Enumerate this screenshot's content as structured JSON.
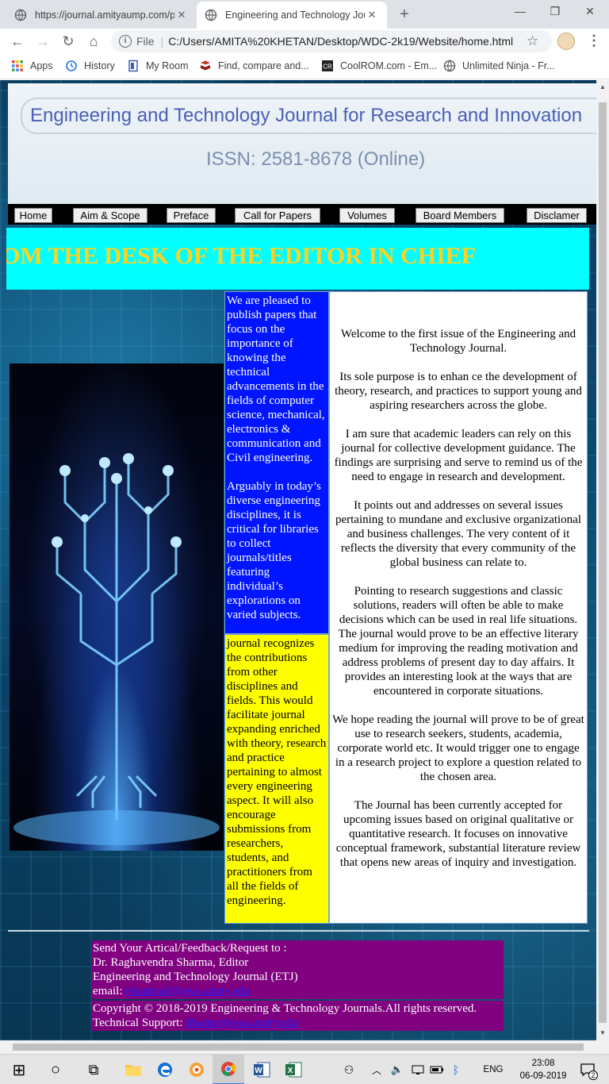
{
  "browser": {
    "tabs": [
      {
        "title": "https://journal.amityaump.com/p",
        "active": false
      },
      {
        "title": "Engineering and Technology Jour",
        "active": true
      }
    ],
    "new_tab": "+",
    "window_controls": {
      "minimize": "—",
      "restore": "❐",
      "close": "✕"
    },
    "toolbar": {
      "back": "←",
      "forward": "→",
      "reload": "↻",
      "home": "⌂",
      "scheme_label": "File",
      "separator": "|",
      "url": "C:/Users/AMITA%20KHETAN/Desktop/WDC-2k19/Website/home.html",
      "star": "☆",
      "menu": "⋮"
    },
    "bookmarks": [
      {
        "label": "Apps",
        "icon": "apps-grid-icon"
      },
      {
        "label": "History",
        "icon": "history-icon"
      },
      {
        "label": "My Room",
        "icon": "page-icon"
      },
      {
        "label": "Find, compare and...",
        "icon": "book-icon"
      },
      {
        "label": "CoolROM.com - Em...",
        "icon": "coolrom-icon"
      },
      {
        "label": "Unlimited Ninja - Fr...",
        "icon": "globe-icon"
      }
    ]
  },
  "site": {
    "journal_title": "Engineering and Technology Journal for Research and Innovation",
    "issn": "ISSN: 2581-8678 (Online)",
    "nav": [
      "Home",
      "Aim & Scope",
      "Preface",
      "Call for Papers",
      "Volumes",
      "Board Members",
      "Disclamer"
    ],
    "editor_heading": "FROM THE DESK OF THE EDITOR IN CHIEF",
    "blue_column": [
      "We are pleased to publish papers that focus on the importance of knowing the technical advancements in the fields of computer science, mechanical, electronics & communication and Civil engineering.",
      "Arguably in today’s diverse engineering disciplines, it is critical for libraries to collect journals/titles featuring individual’s explorations on varied subjects."
    ],
    "yellow_column": "journal recognizes the contributions from other disciplines and fields. This would facilitate journal expanding enriched with theory, research and practice pertaining to almost every engineering aspect. It will also encourage submissions from researchers, students, and practitioners from all the fields of engineering.",
    "welcome": [
      "Welcome to the first issue of the Engineering and Technology Journal.",
      "Its sole purpose is to enhan ce the development of theory, research, and practices to support young and aspiring researchers across the globe.",
      "I am sure that academic leaders can rely on this journal for collective development guidance. The findings are surprising and serve to remind us of the need to engage in research and development.",
      "It points out and addresses on several issues pertaining to mundane and exclusive organizational and business challenges. The very content of it reflects the diversity that every community of the global business can relate to.",
      "Pointing to research suggestions and classic solutions, readers will often be able to make decisions which can be used in real life situations.",
      "The journal would prove to be an effective literary medium for improving the reading motivation and address problems of present day to day affairs. It provides an interesting look at the ways that are encountered in corporate situations.",
      "We hope reading the journal will prove to be of great use to research seekers, students, academia, corporate world etc. It would trigger one to engage in a research project to explore a question related to the chosen area.",
      "The Journal has been currently accepted for upcoming issues based on original qualitative or quantitative research. It focuses on innovative conceptual framework, substantial literature review that opens new areas of inquiry and investigation."
    ],
    "contact": {
      "line1": "Send Your Artical/Feedback/Request to :",
      "line2": "Dr. Raghavendra Sharma, Editor",
      "line3": "Engineering and Technology Journal (ETJ)",
      "email_label": "email:",
      "email": "rsharma3@gwa.amity.edu"
    },
    "copyright": {
      "line1": "Copyright © 2018-2019 Engineering & Technology Journals.All rights reserved.",
      "support_label": "Technical Support:",
      "support_email": "dbarna@gwa.amity.edu"
    }
  },
  "taskbar": {
    "start": "⊞",
    "search": "○",
    "task_view": "⧉",
    "language": "ENG",
    "time": "23:08",
    "date": "06-09-2019",
    "notifications": "2"
  },
  "colors": {
    "nav_bg": "#000000",
    "editor_bar": "#00ffff",
    "editor_text": "#ffd21f",
    "blue_column": "#0015ff",
    "yellow_column": "#ffff00",
    "footer_purple": "#800080",
    "title_blue": "#4b5fb5"
  }
}
